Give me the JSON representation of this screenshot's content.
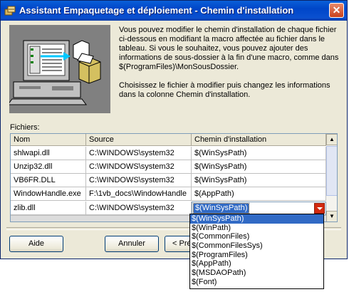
{
  "window": {
    "title": "Assistant Empaquetage et déploiement - Chemin d'installation",
    "close_glyph": "✕"
  },
  "description": {
    "para1": "Vous pouvez modifier le chemin d'installation de chaque fichier\nci-dessous en modifiant la macro affectée au fichier dans le\ntableau. Si vous le souhaitez, vous pouvez ajouter des\ninformations de sous-dossier à la fin d'une macro, comme dans\n$(ProgramFiles)\\MonSousDossier.",
    "para2": "Choisissez le fichier à modifier puis changez les informations\ndans la colonne Chemin d'installation."
  },
  "files_label": "Fichiers:",
  "grid": {
    "columns": [
      "Nom",
      "Source",
      "Chemin d'installation"
    ],
    "rows": [
      {
        "name": "shlwapi.dll",
        "source": "C:\\WINDOWS\\system32",
        "path": "$(WinSysPath)"
      },
      {
        "name": "Unzip32.dll",
        "source": "C:\\WINDOWS\\system32",
        "path": "$(WinSysPath)"
      },
      {
        "name": "VB6FR.DLL",
        "source": "C:\\WINDOWS\\system32",
        "path": "$(WinSysPath)"
      },
      {
        "name": "WindowHandle.exe",
        "source": "F:\\1vb_docs\\WindowHandle",
        "path": "$(AppPath)"
      },
      {
        "name": "zlib.dll",
        "source": "C:\\WINDOWS\\system32",
        "path": "$(WinSysPath)"
      }
    ],
    "editing_value": "$(WinSysPath)"
  },
  "dropdown": {
    "options": [
      "$(WinSysPath)",
      "$(WinPath)",
      "$(CommonFiles)",
      "$(CommonFilesSys)",
      "$(ProgramFiles)",
      "$(AppPath)",
      "$(MSDAOPath)",
      "$(Font)"
    ],
    "selected_index": 0
  },
  "buttons": {
    "help": "Aide",
    "cancel": "Annuler",
    "back": "< Pré"
  },
  "colors": {
    "title_bar": "#0a50d0",
    "selection": "#316ac5",
    "close_button": "#c8401c"
  }
}
